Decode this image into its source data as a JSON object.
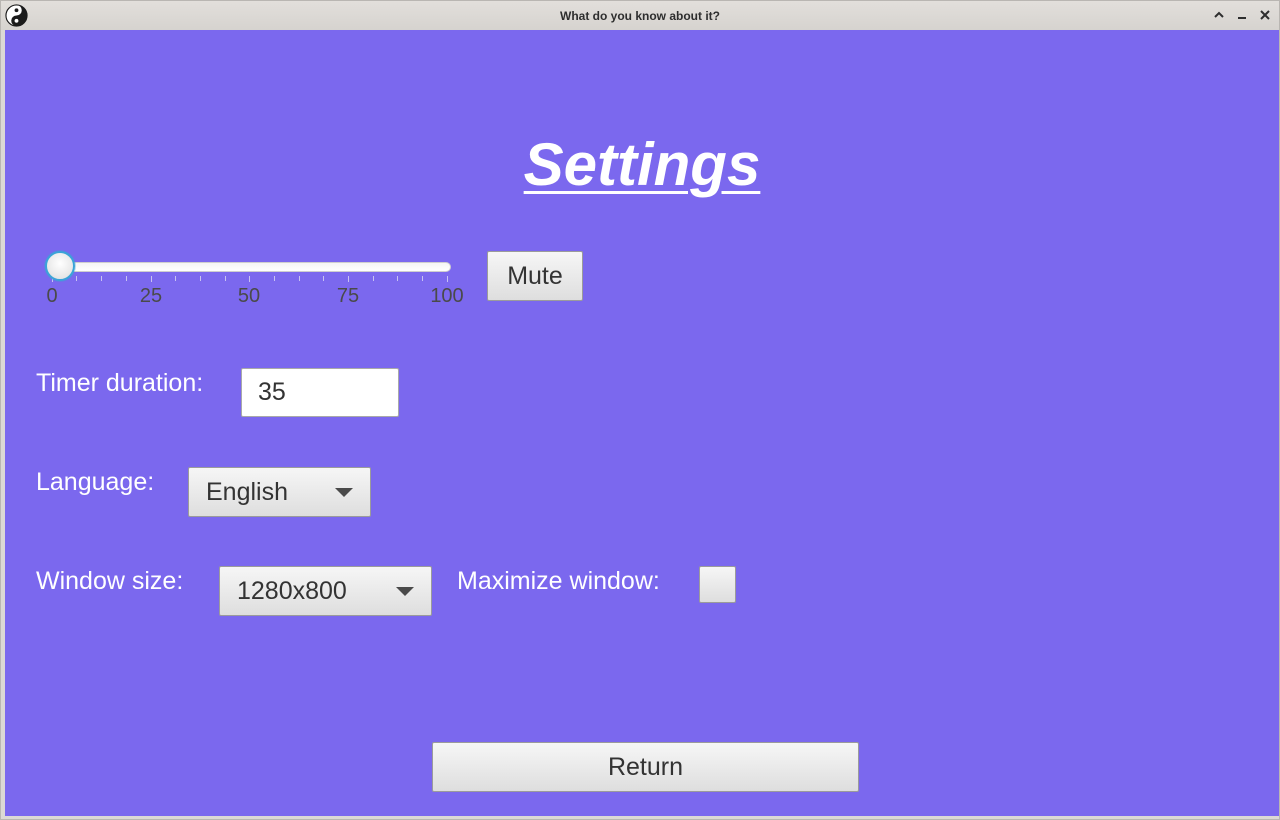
{
  "window": {
    "title": "What do you know about it?",
    "controls": [
      "chevron-up-icon",
      "minimize-icon",
      "close-icon"
    ]
  },
  "colors": {
    "background": "#7b68ee",
    "text": "#ffffff",
    "titlebar": "#dcd9d5",
    "slider_focus": "#3aa4d8"
  },
  "settings": {
    "title": "Settings",
    "volume": {
      "value": 0,
      "min": 0,
      "max": 100,
      "tick_labels": [
        "0",
        "25",
        "50",
        "75",
        "100"
      ]
    },
    "mute_label": "Mute",
    "timer": {
      "label": "Timer duration:",
      "value": "35"
    },
    "language": {
      "label": "Language:",
      "selected": "English"
    },
    "window_size": {
      "label": "Window size:",
      "selected": "1280x800"
    },
    "maximize": {
      "label": "Maximize window:",
      "checked": false
    },
    "return_label": "Return"
  }
}
